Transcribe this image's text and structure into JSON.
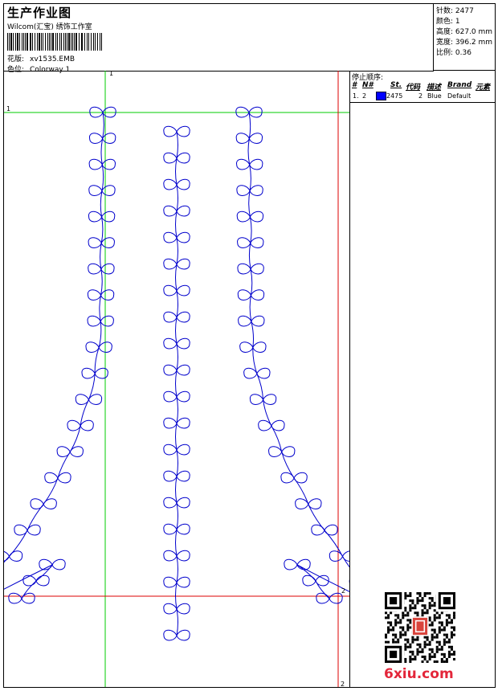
{
  "header": {
    "title": "生产作业图",
    "company": "Wilcom(汇宝)  绣饰工作室",
    "design_label": "花版:",
    "design_value": "xv1535.EMB",
    "colorway_label": "色位:",
    "colorway_value": "Colorway 1"
  },
  "stats": {
    "stitches": "针数: 2477",
    "colors": "颜色: 1",
    "height": "高度: 627.0 mm",
    "width": "宽度: 396.2 mm",
    "scale": "比例: 0.36"
  },
  "stop_panel": {
    "title": "停止顺序:",
    "headers": [
      "#",
      "N#",
      "St.",
      "代码",
      "描述",
      "Brand",
      "元素"
    ],
    "row": {
      "index": "1.",
      "needle": "2",
      "color": "#0000ff",
      "stitches": "2475",
      "code": "2",
      "description": "Blue",
      "brand": "Default"
    }
  },
  "axis_labels": {
    "green_top": "1",
    "green_left": "1",
    "red_right": "2",
    "red_bottom": "2"
  },
  "logo": {
    "text": "6xiu.com"
  },
  "colors": {
    "stitch": "#0000cc",
    "green_guide": "#00cc00",
    "red_guide": "#dd0000"
  }
}
